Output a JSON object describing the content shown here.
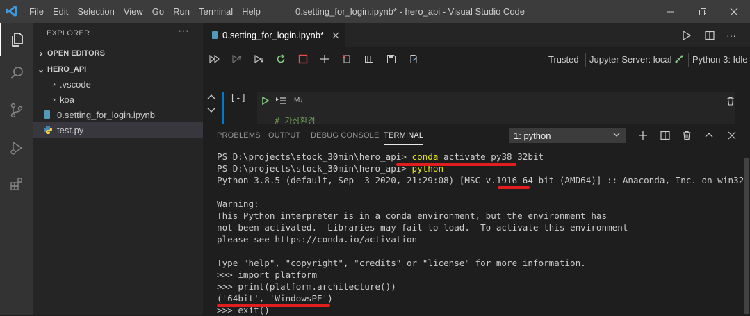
{
  "window": {
    "title": "0.setting_for_login.ipynb* - hero_api - Visual Studio Code",
    "menu": [
      "File",
      "Edit",
      "Selection",
      "View",
      "Go",
      "Run",
      "Terminal",
      "Help"
    ]
  },
  "sidebar": {
    "header": "EXPLORER",
    "more": "···",
    "sections": {
      "open_editors": "OPEN EDITORS",
      "project": "HERO_API"
    },
    "tree": [
      {
        "label": ".vscode",
        "type": "folder"
      },
      {
        "label": "koa",
        "type": "folder"
      },
      {
        "label": "0.setting_for_login.ipynb",
        "type": "notebook"
      },
      {
        "label": "test.py",
        "type": "python",
        "selected": true
      }
    ]
  },
  "editor": {
    "tab_label": "0.setting_for_login.ipynb*",
    "toolbar": {
      "trusted": "Trusted",
      "server": "Jupyter Server: local",
      "kernel": "Python 3: Idle"
    },
    "cell": {
      "exec_count": "[-]",
      "cell_type": "M↓",
      "comment": "# 가상환경"
    }
  },
  "panel": {
    "tabs": [
      "PROBLEMS",
      "OUTPUT",
      "DEBUG CONSOLE",
      "TERMINAL"
    ],
    "active_tab": "TERMINAL",
    "terminal_select": "1: python",
    "terminal_lines": {
      "l1_prompt": "PS D:\\projects\\stock_30min\\hero_api> ",
      "l1_cmd": "conda",
      "l1_rest": " activate py38 32bit",
      "l2_prompt": "PS D:\\projects\\stock_30min\\hero_api> ",
      "l2_cmd": "python",
      "l3": "Python 3.8.5 (default, Sep  3 2020, 21:29:08) [MSC v.1916 64 bit (AMD64)] :: Anaconda, Inc. on win32",
      "l4": "",
      "l5": "Warning:",
      "l6": "This Python interpreter is in a conda environment, but the environment has",
      "l7": "not been activated.  Libraries may fail to load.  To activate this environment",
      "l8": "please see https://conda.io/activation",
      "l9": "",
      "l10": "Type \"help\", \"copyright\", \"credits\" or \"license\" for more information.",
      "l11": ">>> import platform",
      "l12": ">>> print(platform.architecture())",
      "l13": "('64bit', 'WindowsPE')",
      "l14": ">>> exit()"
    }
  },
  "colors": {
    "accent_blue": "#007acc",
    "highlight_yellow": "#e5e510",
    "annotation_red": "#e21d1d",
    "run_green": "#89d185",
    "stop_red": "#f14c4c"
  }
}
